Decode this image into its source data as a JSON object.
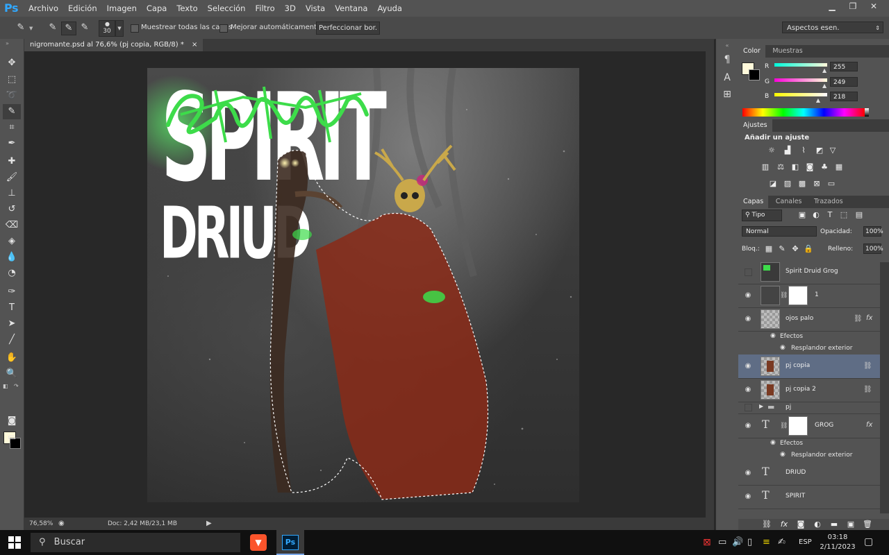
{
  "app": {
    "logo": "Ps"
  },
  "menu": [
    "Archivo",
    "Edición",
    "Imagen",
    "Capa",
    "Texto",
    "Selección",
    "Filtro",
    "3D",
    "Vista",
    "Ventana",
    "Ayuda"
  ],
  "options_bar": {
    "brush_size": "30",
    "sample_all_layers": "Muestrear todas las capas",
    "auto_enhance": "Mejorar automáticamente",
    "refine_edge": "Perfeccionar bor.",
    "workspace": "Aspectos esen."
  },
  "document": {
    "tab_title": "nigromante.psd al 76,6% (pj copia, RGB/8) *",
    "art_title_1": "SPIRIT",
    "art_title_2": "DRIUD",
    "zoom": "76,58%",
    "doc_size": "Doc: 2,42 MB/23,1 MB"
  },
  "color_panel": {
    "tabs": [
      "Color",
      "Muestras"
    ],
    "r_label": "R",
    "g_label": "G",
    "b_label": "B",
    "r": "255",
    "g": "249",
    "b": "218",
    "r_level": 0.96,
    "g_level": 0.96,
    "b_level": 0.84,
    "foreground": "#fff9da",
    "background": "#000000"
  },
  "adjust_panel": {
    "tab": "Ajustes",
    "heading": "Añadir un ajuste"
  },
  "layers_panel": {
    "tabs": [
      "Capas",
      "Canales",
      "Trazados"
    ],
    "filter": "Tipo",
    "blend_mode": "Normal",
    "opacity_label": "Opacidad:",
    "opacity": "100%",
    "lock_label": "Bloq.:",
    "fill_label": "Relleno:",
    "fill": "100%",
    "effects_label": "Efectos",
    "outer_glow": "Resplandor exterior",
    "layers": [
      {
        "name": "Spirit Druid Grog"
      },
      {
        "name": "1"
      },
      {
        "name": "ojos palo"
      },
      {
        "name": "pj copia"
      },
      {
        "name": "pj copia 2"
      },
      {
        "name": "pj"
      },
      {
        "name": "GROG"
      },
      {
        "name": "DRIUD"
      },
      {
        "name": "SPIRIT"
      }
    ]
  },
  "taskbar": {
    "search_placeholder": "Buscar",
    "language": "ESP",
    "time": "03:18",
    "date": "2/11/2023"
  }
}
